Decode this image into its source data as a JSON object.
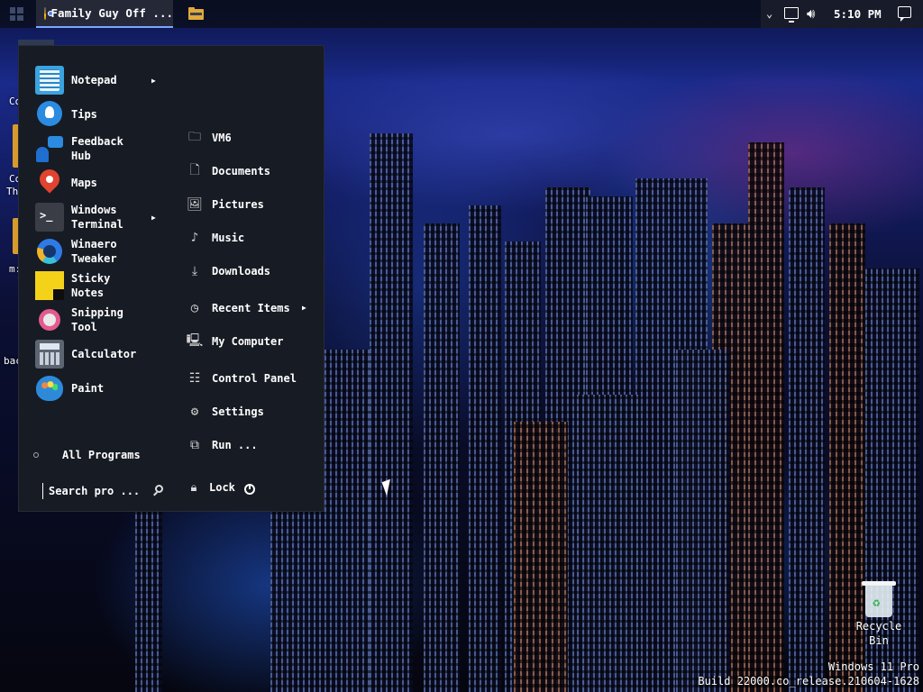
{
  "taskbar": {
    "app_title": "Family Guy Off ...",
    "clock": "5:10 PM"
  },
  "start_menu": {
    "left_items": [
      {
        "label": "Notepad",
        "icon": "notepad-icon",
        "has_submenu": true
      },
      {
        "label": "Tips",
        "icon": "tips-icon",
        "has_submenu": false
      },
      {
        "label": "Feedback Hub",
        "icon": "feedback-hub-icon",
        "has_submenu": false
      },
      {
        "label": "Maps",
        "icon": "maps-icon",
        "has_submenu": false
      },
      {
        "label": "Windows Terminal",
        "icon": "terminal-icon",
        "has_submenu": true
      },
      {
        "label": "Winaero Tweaker",
        "icon": "winaero-icon",
        "has_submenu": false
      },
      {
        "label": "Sticky Notes",
        "icon": "sticky-notes-icon",
        "has_submenu": false
      },
      {
        "label": "Snipping Tool",
        "icon": "snipping-tool-icon",
        "has_submenu": false
      },
      {
        "label": "Calculator",
        "icon": "calculator-icon",
        "has_submenu": false
      },
      {
        "label": "Paint",
        "icon": "paint-icon",
        "has_submenu": false
      }
    ],
    "right_items": [
      {
        "label": "VM6",
        "icon": "user-folder-icon"
      },
      {
        "label": "Documents",
        "icon": "document-icon"
      },
      {
        "label": "Pictures",
        "icon": "picture-icon"
      },
      {
        "label": "Music",
        "icon": "music-icon"
      },
      {
        "label": "Downloads",
        "icon": "download-icon"
      },
      {
        "label": "Recent Items",
        "icon": "clock-icon",
        "has_submenu": true
      },
      {
        "label": "My Computer",
        "icon": "computer-icon"
      },
      {
        "label": "Control Panel",
        "icon": "control-panel-icon"
      },
      {
        "label": "Settings",
        "icon": "gear-icon"
      },
      {
        "label": "Run ...",
        "icon": "run-icon"
      }
    ],
    "all_programs": "All Programs",
    "search_text": "Search pro ...",
    "lock": "Lock"
  },
  "desktop": {
    "recycle_bin_line1": "Recycle",
    "recycle_bin_line2": "Bin",
    "watermark_line1": "Windows 11 Pro",
    "watermark_line2": "Build 22000.co_release.210604-1628",
    "fragments": [
      "Co",
      "Co",
      "Th",
      "m:",
      "bac"
    ]
  }
}
